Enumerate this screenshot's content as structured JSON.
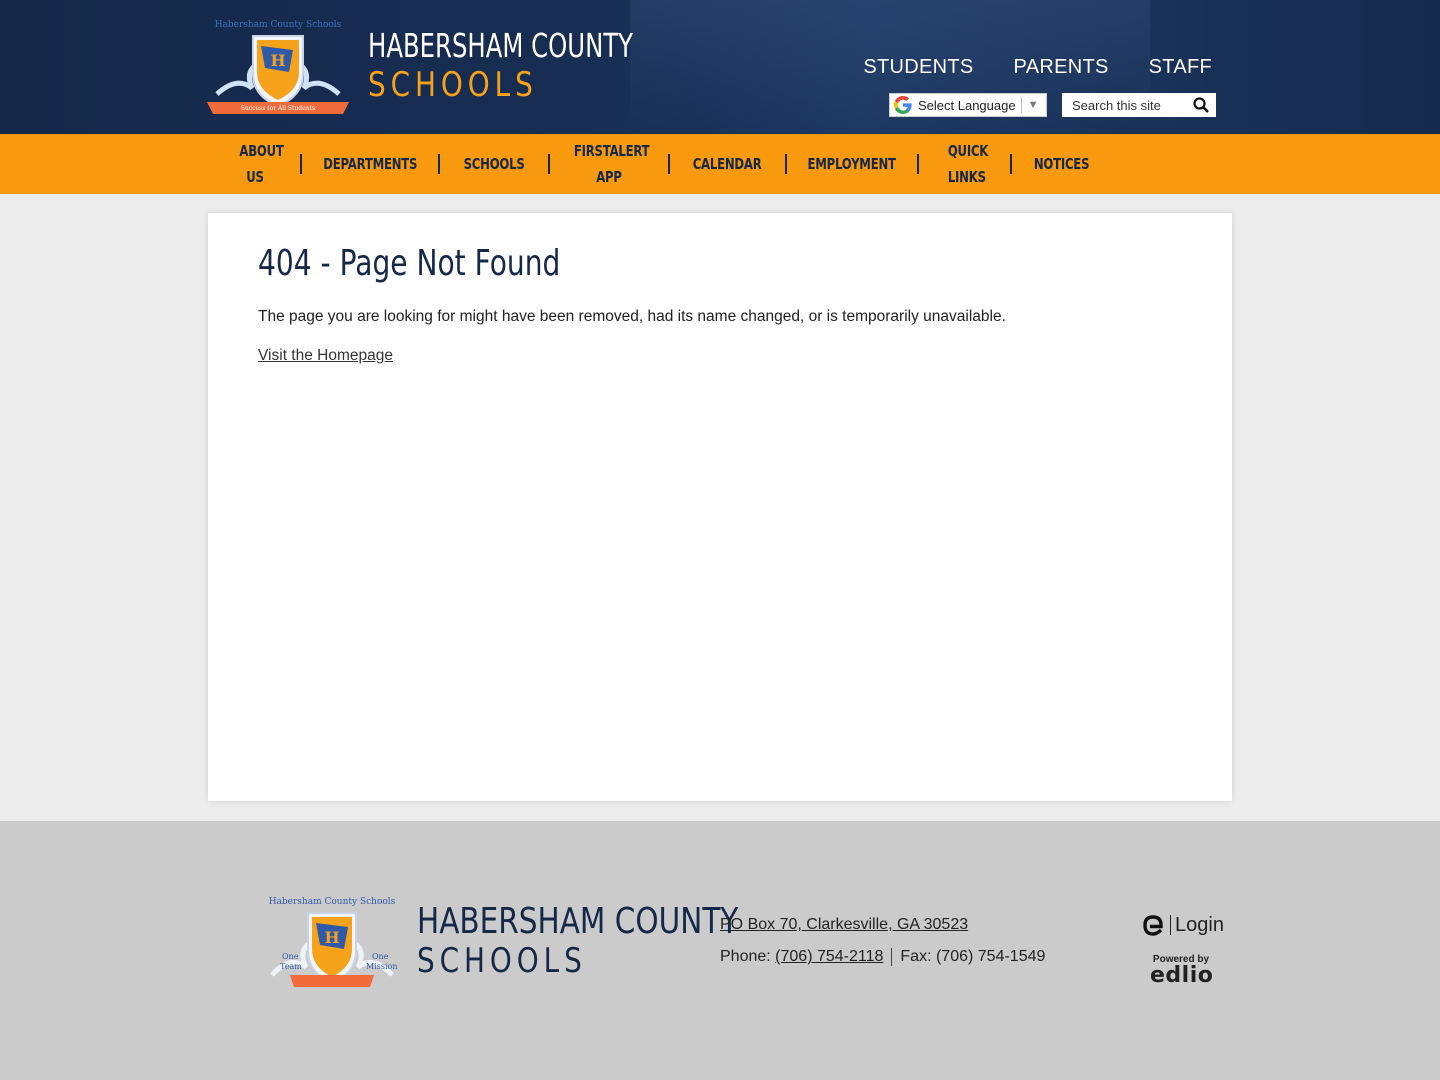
{
  "header": {
    "site_name_line1": "HABERSHAM COUNTY",
    "site_name_line2": "SCHOOLS",
    "logo_top_text": "Habersham County Schools",
    "logo_ribbon_text": "Success for All Students",
    "audience_links": [
      "STUDENTS",
      "PARENTS",
      "STAFF"
    ],
    "translate_label": "Select Language",
    "search_placeholder": "Search this site"
  },
  "nav": {
    "items": [
      "ABOUT US",
      "DEPARTMENTS",
      "SCHOOLS",
      "FIRSTALERT APP",
      "CALENDAR",
      "EMPLOYMENT",
      "QUICK LINKS",
      "NOTICES"
    ]
  },
  "main": {
    "title": "404 - Page Not Found",
    "message": "The page you are looking for might have been removed, had its name changed, or is temporarily unavailable.",
    "home_link": "Visit the Homepage"
  },
  "footer": {
    "site_name_line1": "HABERSHAM COUNTY",
    "site_name_line2": "SCHOOLS",
    "address": "PO Box 70, Clarkesville, GA 30523",
    "phone_label": "Phone:",
    "phone": "(706) 754-2118",
    "fax": "Fax: (706) 754-1549",
    "login": "Login",
    "powered_by": "Powered by",
    "powered_brand": "edlio"
  },
  "colors": {
    "navy": "#15284a",
    "orange": "#f99a0e",
    "gold_text": "#f7a21b",
    "footer_bg": "#cbcbcb"
  }
}
